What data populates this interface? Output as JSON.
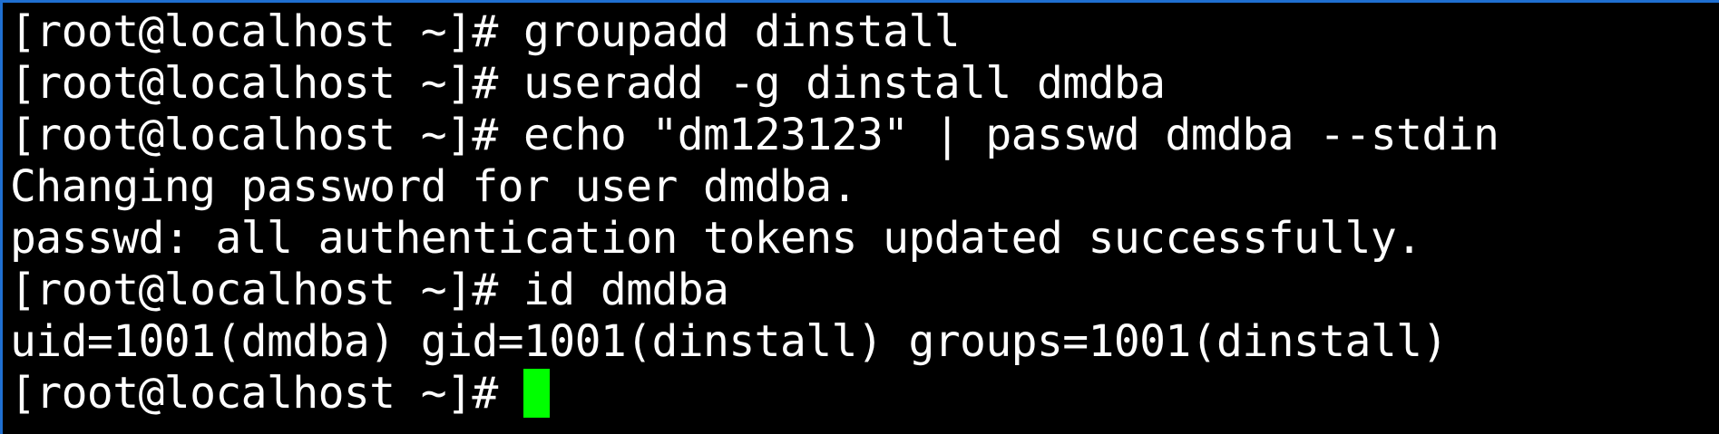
{
  "terminal": {
    "cursor_color": "#00ff00",
    "background_color": "#000000",
    "text_color": "#ffffff",
    "border_color": "#1f6fd1",
    "lines": [
      "[root@localhost ~]# groupadd dinstall",
      "[root@localhost ~]# useradd -g dinstall dmdba",
      "[root@localhost ~]# echo \"dm123123\" | passwd dmdba --stdin",
      "Changing password for user dmdba.",
      "passwd: all authentication tokens updated successfully.",
      "[root@localhost ~]# id dmdba",
      "uid=1001(dmdba) gid=1001(dinstall) groups=1001(dinstall)"
    ],
    "prompt": "[root@localhost ~]# "
  }
}
